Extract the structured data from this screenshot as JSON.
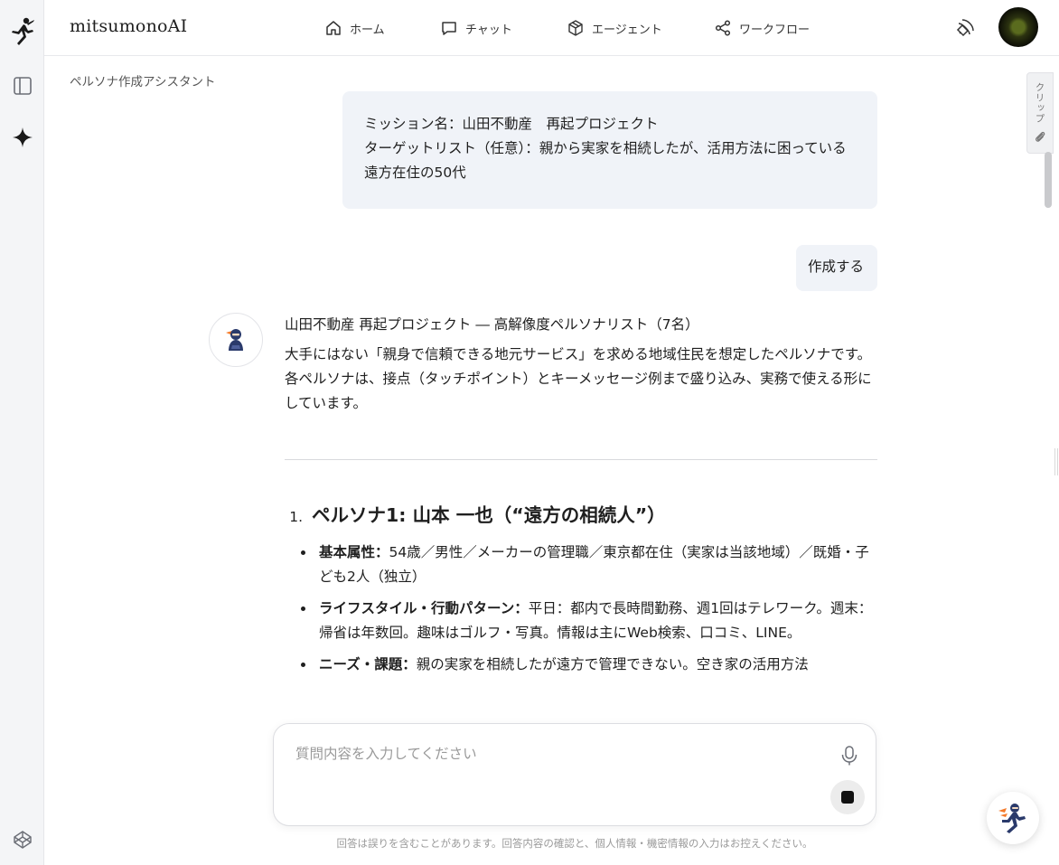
{
  "app": {
    "brand": "mitsumonoAI"
  },
  "header": {
    "nav": [
      {
        "label": "ホーム",
        "icon": "home-icon"
      },
      {
        "label": "チャット",
        "icon": "chat-icon"
      },
      {
        "label": "エージェント",
        "icon": "cube-icon"
      },
      {
        "label": "ワークフロー",
        "icon": "share-icon"
      }
    ]
  },
  "breadcrumb": "ペルソナ作成アシスタント",
  "clip": {
    "label": "クリップ"
  },
  "messages": {
    "user1": {
      "line1": "ミッション名：山田不動産　再起プロジェクト",
      "line2": "ターゲットリスト（任意）：親から実家を相続したが、活用方法に困っている遠方在住の50代"
    },
    "user2": "作成する",
    "answer": {
      "title": "山田不動産 再起プロジェクト ― 高解像度ペルソナリスト（7名）",
      "lead": "大手にはない「親身で信頼できる地元サービス」を求める地域住民を想定したペルソナです。各ペルソナは、接点（タッチポイント）とキーメッセージ例まで盛り込み、実務で使える形にしています。",
      "persona1": {
        "num": "1.",
        "heading": "ペルソナ1: 山本 一也（“遠方の相続人”）",
        "items": [
          {
            "label": "基本属性：",
            "text": "54歳／男性／メーカーの管理職／東京都在住（実家は当該地域）／既婚・子ども2人（独立）"
          },
          {
            "label": "ライフスタイル・行動パターン：",
            "text": "平日：都内で長時間勤務、週1回はテレワーク。週末：帰省は年数回。趣味はゴルフ・写真。情報は主にWeb検索、口コミ、LINE。"
          },
          {
            "label": "ニーズ・課題：",
            "text": "親の実家を相続したが遠方で管理できない。空き家の活用方法"
          }
        ]
      }
    }
  },
  "composer": {
    "placeholder": "質問内容を入力してください"
  },
  "disclaimer": "回答は誤りを含むことがあります。回答内容の確認と、個人情報・機密情報の入力はお控えください。",
  "colors": {
    "bubble": "#f0f3f8",
    "rail": "#f4f5f7",
    "accent_orange": "#f47a2a",
    "ninja_navy": "#2a3a6b"
  }
}
